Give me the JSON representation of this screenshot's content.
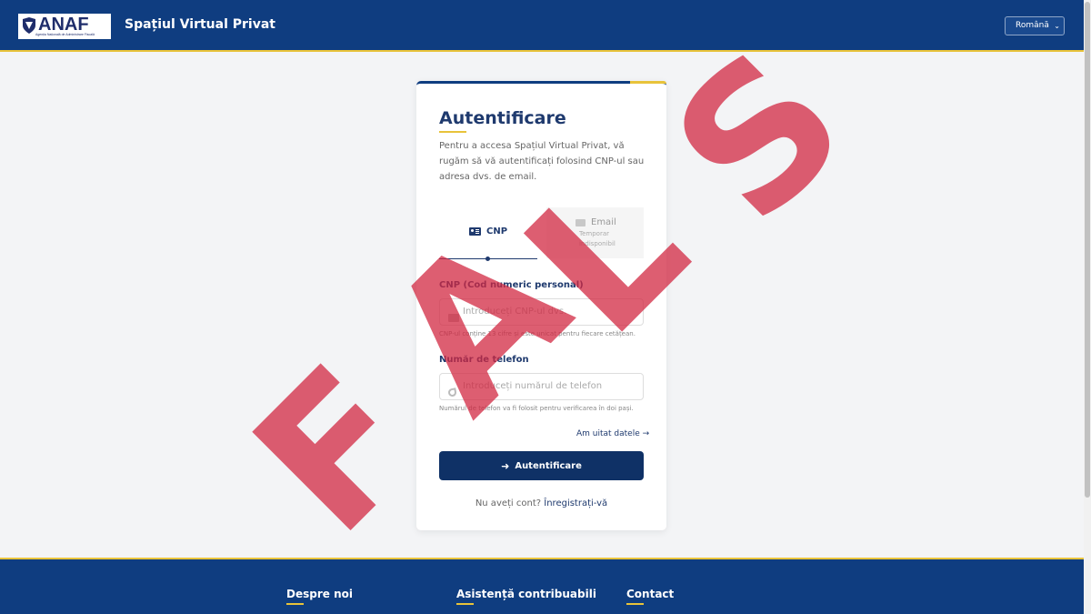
{
  "header": {
    "logo_text": "ANAF",
    "logo_subtitle": "Agenția Națională de Administrare Fiscală",
    "title": "Spațiul Virtual Privat",
    "language": "Română"
  },
  "login": {
    "title": "Autentificare",
    "description": "Pentru a accesa Spațiul Virtual Privat, vă rugăm să vă autentificați folosind CNP-ul sau adresa dvs. de email.",
    "tabs": [
      {
        "label": "CNP",
        "icon": "id-card-icon",
        "active": true
      },
      {
        "label": "Email",
        "sublabel": "Temporar indisponibil",
        "icon": "envelope-icon",
        "active": false
      }
    ],
    "cnp_label": "CNP (Cod numeric personal)",
    "cnp_placeholder": "Introduceți CNP-ul dvs.",
    "cnp_help": "CNP-ul conține 13 cifre și este unicat pentru fiecare cetățean.",
    "phone_label": "Număr de telefon",
    "phone_placeholder": "Introduceți numărul de telefon",
    "phone_help": "Numărul de telefon va fi folosit pentru verificarea în doi pași.",
    "forgot_link": "Am uitat datele →",
    "submit_label": "Autentificare",
    "register_prompt": "Nu aveți cont?",
    "register_link": "Înregistrați-vă"
  },
  "footer": {
    "columns": [
      "Despre noi",
      "Asistență contribuabili",
      "Contact"
    ]
  },
  "watermark": {
    "letters": [
      "F",
      "A",
      "L",
      "S"
    ]
  },
  "colors": {
    "primary": "#0f3d80",
    "accent": "#e8c33a",
    "button": "#0f3166",
    "watermark": "#d22841"
  }
}
